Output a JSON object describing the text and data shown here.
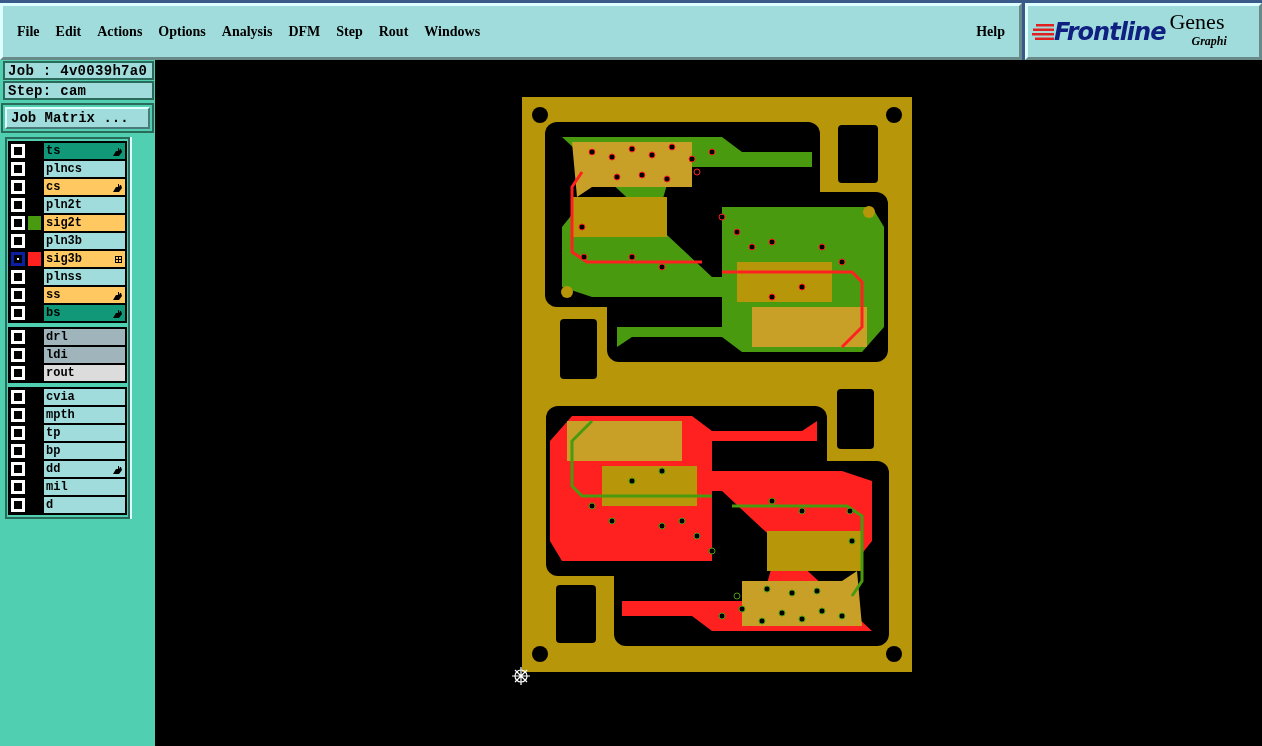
{
  "menu": [
    "File",
    "Edit",
    "Actions",
    "Options",
    "Analysis",
    "DFM",
    "Step",
    "Rout",
    "Windows"
  ],
  "help": "Help",
  "logo": {
    "brand": "Frontline",
    "product": "Genes",
    "subtitle": "Graphi"
  },
  "job": "Job : 4v0039h7a0",
  "step": "Step: cam",
  "job_matrix_button": "Job Matrix ...",
  "layer_groups": [
    [
      {
        "name": "ts",
        "color": "#109878",
        "selected": false,
        "hand_marker": true,
        "work_layer": false
      },
      {
        "name": "plncs",
        "color": "#a0dcdc",
        "selected": false,
        "hand_marker": false,
        "work_layer": false
      },
      {
        "name": "cs",
        "color": "#ffc860",
        "selected": false,
        "hand_marker": true,
        "work_layer": false
      },
      {
        "name": "pln2t",
        "color": "#a0dcdc",
        "selected": false,
        "hand_marker": false,
        "work_layer": false
      },
      {
        "name": "sig2t",
        "color": "#ffc860",
        "swatch": {
          "color": "#4a9a10"
        },
        "selected": false,
        "hand_marker": false,
        "work_layer": false
      },
      {
        "name": "pln3b",
        "color": "#a0dcdc",
        "selected": false,
        "hand_marker": false,
        "work_layer": false
      },
      {
        "name": "sig3b",
        "color": "#ffc860",
        "swatch": {
          "color": "#ff2020"
        },
        "selected": true,
        "hand_marker": false,
        "work_layer": true
      },
      {
        "name": "plnss",
        "color": "#a0dcdc",
        "selected": false,
        "hand_marker": false,
        "work_layer": false
      },
      {
        "name": "ss",
        "color": "#ffc860",
        "selected": false,
        "hand_marker": true,
        "work_layer": false
      },
      {
        "name": "bs",
        "color": "#109878",
        "selected": false,
        "hand_marker": true,
        "work_layer": false
      }
    ],
    [
      {
        "name": "drl",
        "color": "#a0b4bc",
        "selected": false,
        "hand_marker": false,
        "work_layer": false
      },
      {
        "name": "ldi",
        "color": "#a0b4bc",
        "selected": false,
        "hand_marker": false,
        "work_layer": false
      },
      {
        "name": "rout",
        "color": "#dcdcdc",
        "selected": false,
        "hand_marker": false,
        "work_layer": false
      }
    ],
    [
      {
        "name": "cvia",
        "color": "#a0dcdc",
        "selected": false,
        "hand_marker": false,
        "work_layer": false
      },
      {
        "name": "mpth",
        "color": "#a0dcdc",
        "selected": false,
        "hand_marker": false,
        "work_layer": false
      },
      {
        "name": "tp",
        "color": "#a0dcdc",
        "selected": false,
        "hand_marker": false,
        "work_layer": false
      },
      {
        "name": "bp",
        "color": "#a0dcdc",
        "selected": false,
        "hand_marker": false,
        "work_layer": false
      },
      {
        "name": "dd",
        "color": "#a0dcdc",
        "selected": false,
        "hand_marker": true,
        "work_layer": false
      },
      {
        "name": "mil",
        "color": "#a0dcdc",
        "selected": false,
        "hand_marker": false,
        "work_layer": false
      },
      {
        "name": "d",
        "color": "#a0dcdc",
        "selected": false,
        "hand_marker": false,
        "work_layer": false
      }
    ]
  ]
}
